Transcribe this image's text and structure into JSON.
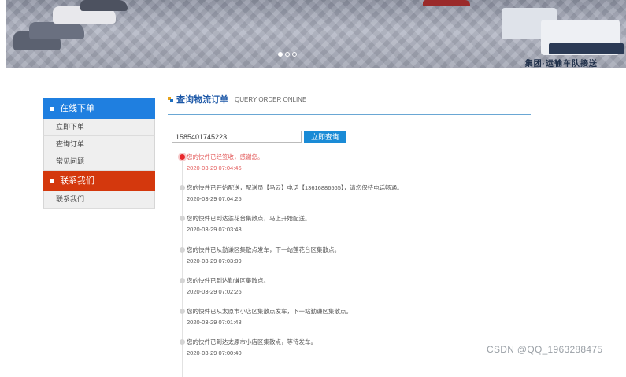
{
  "banner": {
    "logo_text": "集团·运输车队接送",
    "slides": 3,
    "active_slide": 1
  },
  "sidebar": {
    "section1": {
      "title": "在线下单"
    },
    "items1": [
      {
        "label": "立即下单"
      },
      {
        "label": "查询订单"
      },
      {
        "label": "常见问题"
      }
    ],
    "section2": {
      "title": "联系我们"
    },
    "items2": [
      {
        "label": "联系我们"
      }
    ]
  },
  "main": {
    "title_cn": "查询物流订单",
    "title_en": "QUERY ORDER ONLINE",
    "search": {
      "value": "1585401745223",
      "button_label": "立即查询"
    },
    "timeline": [
      {
        "message": "您的快件已经签收，感谢您。",
        "time": "2020-03-29 07:04:46",
        "current": true
      },
      {
        "message": "您的快件已开始配送，配送员【马云】电话【13616886565】，请您保持电话畅通。",
        "time": "2020-03-29 07:04:25"
      },
      {
        "message": "您的快件已到达莲花台集散点，马上开始配送。",
        "time": "2020-03-29 07:03:43"
      },
      {
        "message": "您的快件已从勤谦区集散点发车，下一站莲花台区集散点。",
        "time": "2020-03-29 07:03:09"
      },
      {
        "message": "您的快件已到达勤谦区集散点。",
        "time": "2020-03-29 07:02:26"
      },
      {
        "message": "您的快件已从太原市小店区集散点发车，下一站勤谦区集散点。",
        "time": "2020-03-29 07:01:48"
      },
      {
        "message": "您的快件已到达太原市小店区集散点，等待发车。",
        "time": "2020-03-29 07:00:40"
      }
    ]
  },
  "watermark": "CSDN @QQ_1963288475",
  "colors": {
    "accent_blue": "#1f7fe0",
    "accent_red": "#d4380d",
    "button_blue": "#1a8bd6",
    "current_status": "#e8262a"
  }
}
